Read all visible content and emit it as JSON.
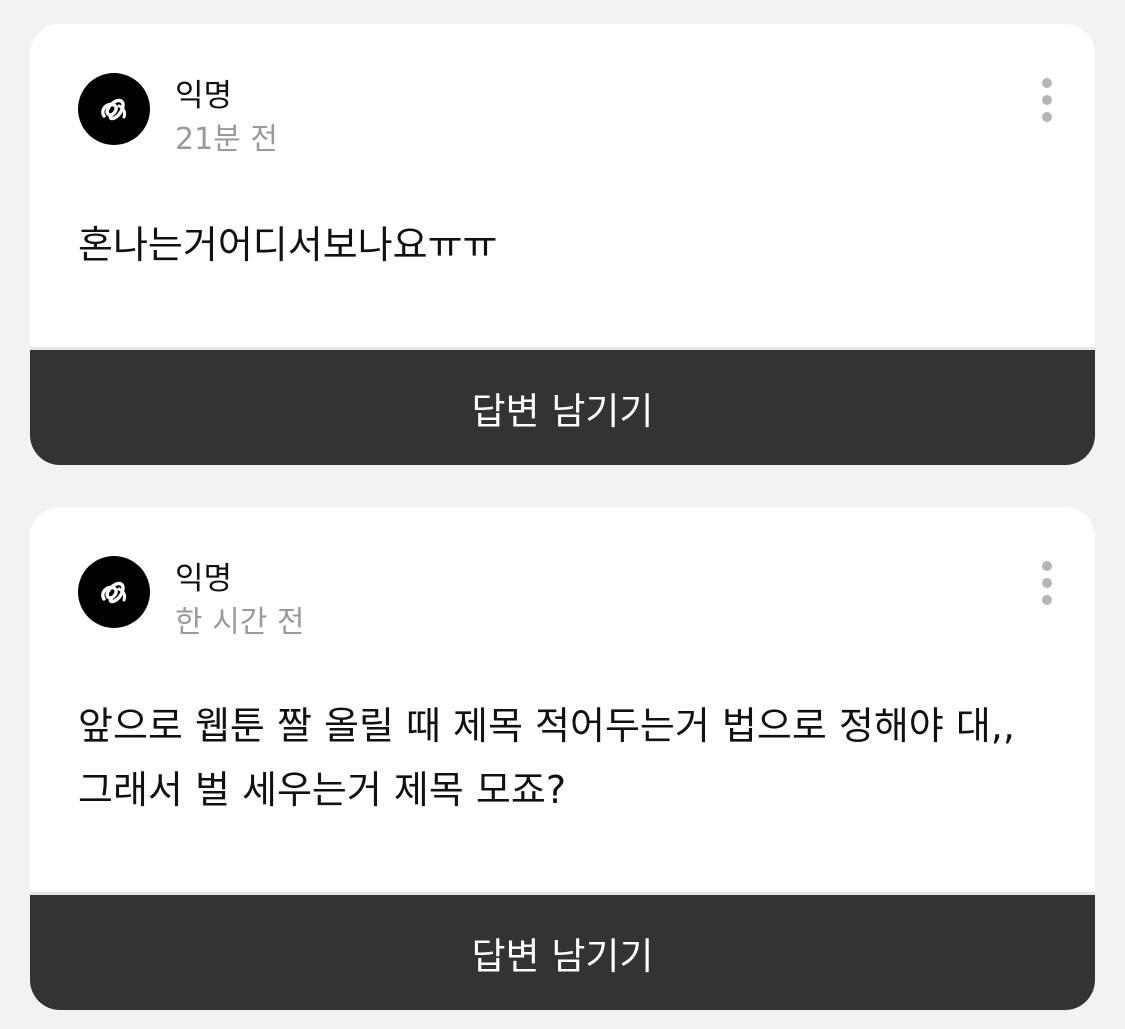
{
  "posts": [
    {
      "author": "익명",
      "time": "21분 전",
      "content": "혼나는거어디서보나요ㅠㅠ",
      "reply_label": "답변 남기기",
      "avatar_icon": "anonymous-logo-icon",
      "more_icon": "more-vertical-icon"
    },
    {
      "author": "익명",
      "time": "한 시간 전",
      "content": "앞으로 웹툰 짤 올릴 때 제목 적어두는거 법으로 정해야 대,, 그래서 벌 세우는거 제목 모죠?",
      "reply_label": "답변 남기기",
      "avatar_icon": "anonymous-logo-icon",
      "more_icon": "more-vertical-icon"
    }
  ],
  "colors": {
    "background": "#f2f2f4",
    "card": "#ffffff",
    "button": "#333333",
    "muted_text": "#9a9a9a"
  }
}
